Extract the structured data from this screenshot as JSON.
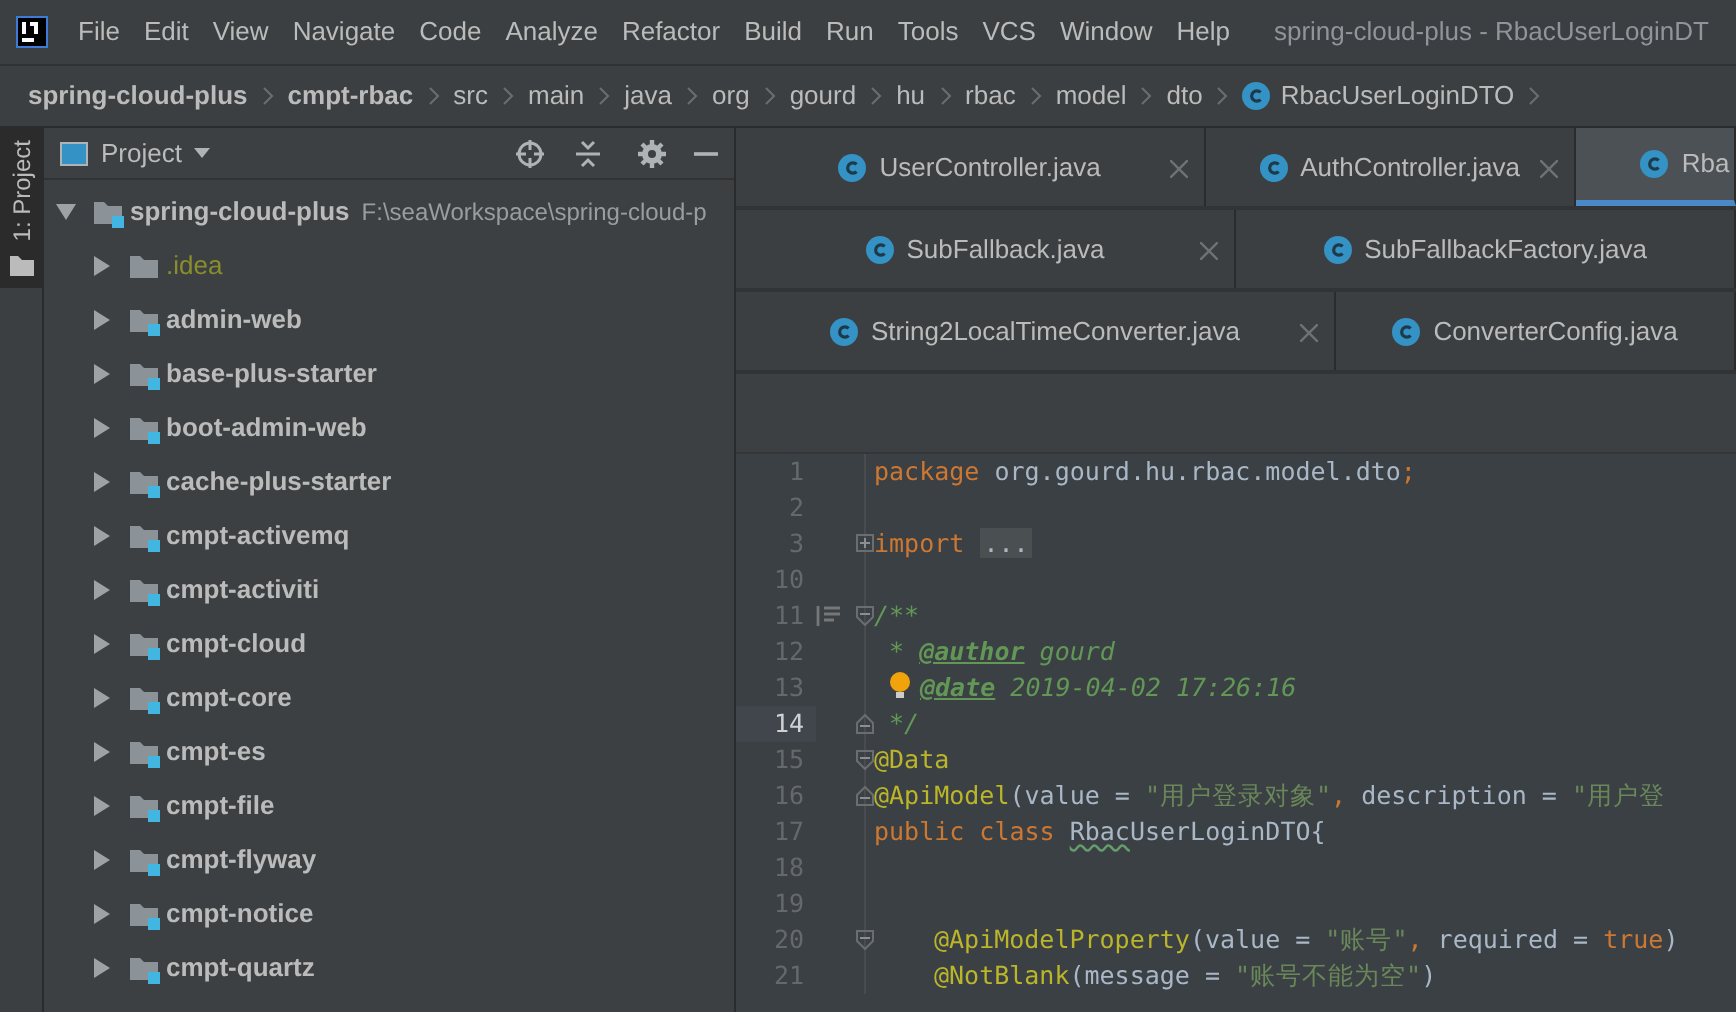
{
  "window": {
    "title": "spring-cloud-plus - RbacUserLoginDT"
  },
  "menu": [
    "File",
    "Edit",
    "View",
    "Navigate",
    "Code",
    "Analyze",
    "Refactor",
    "Build",
    "Run",
    "Tools",
    "VCS",
    "Window",
    "Help"
  ],
  "breadcrumbs": [
    {
      "label": "spring-cloud-plus",
      "kind": "module"
    },
    {
      "label": "cmpt-rbac",
      "kind": "module"
    },
    {
      "label": "src",
      "kind": "folder"
    },
    {
      "label": "main",
      "kind": "folder"
    },
    {
      "label": "java",
      "kind": "folder"
    },
    {
      "label": "org",
      "kind": "folder"
    },
    {
      "label": "gourd",
      "kind": "folder"
    },
    {
      "label": "hu",
      "kind": "folder"
    },
    {
      "label": "rbac",
      "kind": "folder"
    },
    {
      "label": "model",
      "kind": "folder"
    },
    {
      "label": "dto",
      "kind": "folder"
    },
    {
      "label": "RbacUserLoginDTO",
      "kind": "class"
    }
  ],
  "side_tab": {
    "label": "1: Project",
    "selected": true
  },
  "project_panel": {
    "title": "Project",
    "tree": [
      {
        "label": "spring-cloud-plus",
        "path": "F:\\seaWorkspace\\spring-cloud-p",
        "kind": "module",
        "expanded": true,
        "children": [
          {
            "label": ".idea",
            "kind": "folder",
            "expanded": false
          },
          {
            "label": "admin-web",
            "kind": "module",
            "expanded": false
          },
          {
            "label": "base-plus-starter",
            "kind": "module",
            "expanded": false
          },
          {
            "label": "boot-admin-web",
            "kind": "module",
            "expanded": false
          },
          {
            "label": "cache-plus-starter",
            "kind": "module",
            "expanded": false
          },
          {
            "label": "cmpt-activemq",
            "kind": "module",
            "expanded": false
          },
          {
            "label": "cmpt-activiti",
            "kind": "module",
            "expanded": false
          },
          {
            "label": "cmpt-cloud",
            "kind": "module",
            "expanded": false
          },
          {
            "label": "cmpt-core",
            "kind": "module",
            "expanded": false
          },
          {
            "label": "cmpt-es",
            "kind": "module",
            "expanded": false
          },
          {
            "label": "cmpt-file",
            "kind": "module",
            "expanded": false
          },
          {
            "label": "cmpt-flyway",
            "kind": "module",
            "expanded": false
          },
          {
            "label": "cmpt-notice",
            "kind": "module",
            "expanded": false
          },
          {
            "label": "cmpt-quartz",
            "kind": "module",
            "expanded": false
          }
        ]
      }
    ]
  },
  "tab_rows": [
    [
      {
        "label": "UserController.java",
        "selected": false,
        "closable": true
      },
      {
        "label": "AuthController.java",
        "selected": false,
        "closable": true
      },
      {
        "label": "Rba",
        "selected": true,
        "closable": false
      }
    ],
    [
      {
        "label": "SubFallback.java",
        "selected": false,
        "closable": true
      },
      {
        "label": "SubFallbackFactory.java",
        "selected": false,
        "closable": false
      }
    ],
    [
      {
        "label": "String2LocalTimeConverter.java",
        "selected": false,
        "closable": true
      },
      {
        "label": "ConverterConfig.java",
        "selected": false,
        "closable": false
      }
    ]
  ],
  "code": [
    {
      "number": "1",
      "current": false,
      "kind": "plain",
      "tokens": [
        {
          "kind": "keyword",
          "text": "package "
        },
        {
          "kind": "plain",
          "text": "org.gourd.hu.rbac.model.dto"
        },
        {
          "kind": "keyword",
          "text": ";"
        }
      ]
    },
    {
      "number": "2",
      "current": false,
      "kind": "plain"
    },
    {
      "number": "3",
      "current": false,
      "kind": "foldplus",
      "tokens": [
        {
          "kind": "keyword",
          "text": "import "
        },
        {
          "kind": "folded",
          "text": "..."
        }
      ]
    },
    {
      "number": "10",
      "current": false,
      "kind": "plain"
    },
    {
      "number": "11",
      "current": false,
      "kind": "docfoldstart",
      "tokens": [
        {
          "kind": "comment",
          "text": "/**"
        }
      ]
    },
    {
      "number": "12",
      "current": false,
      "kind": "plain",
      "tokens": [
        {
          "kind": "comment",
          "text": " * "
        },
        {
          "kind": "doctag",
          "text": "@author"
        },
        {
          "kind": "comment",
          "text": " gourd"
        }
      ]
    },
    {
      "number": "13",
      "current": false,
      "kind": "bulb",
      "tokens": [
        {
          "kind": "doctag",
          "text": "@date"
        },
        {
          "kind": "comment",
          "text": " 2019-04-02 17:26:16"
        }
      ]
    },
    {
      "number": "14",
      "current": true,
      "kind": "foldend",
      "tokens": [
        {
          "kind": "comment",
          "text": " */"
        }
      ]
    },
    {
      "number": "15",
      "current": false,
      "kind": "foldstart",
      "tokens": [
        {
          "kind": "annotation",
          "text": "@Data"
        }
      ]
    },
    {
      "number": "16",
      "current": false,
      "kind": "foldend",
      "tokens": [
        {
          "kind": "annotation",
          "text": "@ApiModel"
        },
        {
          "kind": "plain",
          "text": "(value = "
        },
        {
          "kind": "string",
          "text": "\"用户登录对象\""
        },
        {
          "kind": "keyword",
          "text": ", "
        },
        {
          "kind": "plain",
          "text": "description = "
        },
        {
          "kind": "string",
          "text": "\"用户登"
        }
      ]
    },
    {
      "number": "17",
      "current": false,
      "kind": "plain",
      "tokens": [
        {
          "kind": "keyword",
          "text": "public class "
        },
        {
          "kind": "typo",
          "text": "Rbac"
        },
        {
          "kind": "plain",
          "text": "UserLoginDTO{"
        }
      ]
    },
    {
      "number": "18",
      "current": false,
      "kind": "plain"
    },
    {
      "number": "19",
      "current": false,
      "kind": "plain"
    },
    {
      "number": "20",
      "current": false,
      "kind": "foldstart",
      "indented": true,
      "tokens": [
        {
          "kind": "annotation",
          "text": "@ApiModelProperty"
        },
        {
          "kind": "plain",
          "text": "(value = "
        },
        {
          "kind": "string",
          "text": "\"账号\""
        },
        {
          "kind": "keyword",
          "text": ", "
        },
        {
          "kind": "plain",
          "text": "required = "
        },
        {
          "kind": "keyword",
          "text": "true"
        },
        {
          "kind": "plain",
          "text": ")"
        }
      ]
    },
    {
      "number": "21",
      "current": false,
      "kind": "plain",
      "indented": true,
      "tokens": [
        {
          "kind": "annotation",
          "text": "@NotBlank"
        },
        {
          "kind": "plain",
          "text": "(message = "
        },
        {
          "kind": "string",
          "text": "\"账号不能为空\""
        },
        {
          "kind": "plain",
          "text": ")"
        }
      ]
    }
  ]
}
